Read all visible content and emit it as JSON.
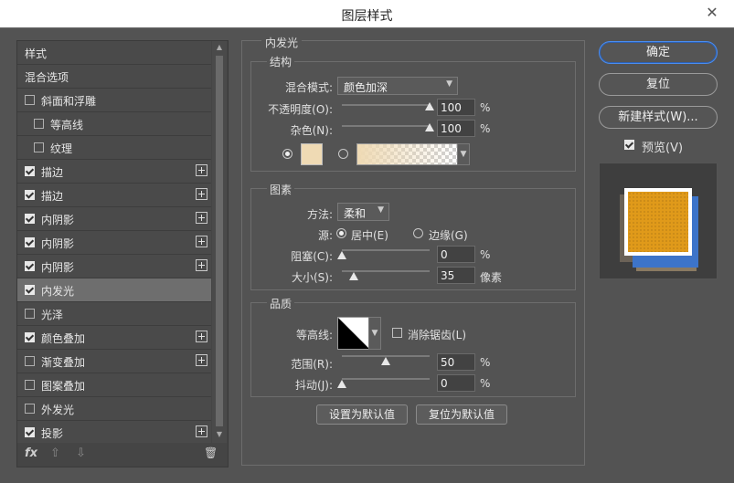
{
  "window": {
    "title": "图层样式",
    "close_glyph": "✕"
  },
  "left": {
    "header": "样式",
    "items": [
      {
        "label": "混合选项",
        "checkbox": false,
        "checked": false,
        "plus": false,
        "active": false,
        "indent": 0
      },
      {
        "label": "斜面和浮雕",
        "checkbox": true,
        "checked": false,
        "plus": false,
        "active": false,
        "indent": 0
      },
      {
        "label": "等高线",
        "checkbox": true,
        "checked": false,
        "plus": false,
        "active": false,
        "indent": 1
      },
      {
        "label": "纹理",
        "checkbox": true,
        "checked": false,
        "plus": false,
        "active": false,
        "indent": 1
      },
      {
        "label": "描边",
        "checkbox": true,
        "checked": true,
        "plus": true,
        "active": false,
        "indent": 0
      },
      {
        "label": "描边",
        "checkbox": true,
        "checked": true,
        "plus": true,
        "active": false,
        "indent": 0
      },
      {
        "label": "内阴影",
        "checkbox": true,
        "checked": true,
        "plus": true,
        "active": false,
        "indent": 0
      },
      {
        "label": "内阴影",
        "checkbox": true,
        "checked": true,
        "plus": true,
        "active": false,
        "indent": 0
      },
      {
        "label": "内阴影",
        "checkbox": true,
        "checked": true,
        "plus": true,
        "active": false,
        "indent": 0
      },
      {
        "label": "内发光",
        "checkbox": true,
        "checked": true,
        "plus": false,
        "active": true,
        "indent": 0
      },
      {
        "label": "光泽",
        "checkbox": true,
        "checked": false,
        "plus": false,
        "active": false,
        "indent": 0
      },
      {
        "label": "颜色叠加",
        "checkbox": true,
        "checked": true,
        "plus": true,
        "active": false,
        "indent": 0
      },
      {
        "label": "渐变叠加",
        "checkbox": true,
        "checked": false,
        "plus": true,
        "active": false,
        "indent": 0
      },
      {
        "label": "图案叠加",
        "checkbox": true,
        "checked": false,
        "plus": false,
        "active": false,
        "indent": 0
      },
      {
        "label": "外发光",
        "checkbox": true,
        "checked": false,
        "plus": false,
        "active": false,
        "indent": 0
      },
      {
        "label": "投影",
        "checkbox": true,
        "checked": true,
        "plus": true,
        "active": false,
        "indent": 0
      }
    ],
    "footer": {
      "fx": "fx",
      "up": "⇧",
      "down": "⇩",
      "trash": "🗑"
    }
  },
  "inner_glow": {
    "title": "内发光",
    "structure": {
      "title": "结构",
      "blend_mode_label": "混合模式:",
      "blend_mode_value": "颜色加深",
      "opacity_label": "不透明度(O):",
      "opacity_value": "100",
      "opacity_unit": "%",
      "opacity_level": 1.0,
      "noise_label": "杂色(N):",
      "noise_value": "100",
      "noise_unit": "%",
      "noise_level": 1.0,
      "glow_color": "#efdab4"
    },
    "elements": {
      "title": "图素",
      "method_label": "方法:",
      "method_value": "柔和",
      "source_label": "源:",
      "source_center": "居中(E)",
      "source_edge": "边缘(G)",
      "choke_label": "阻塞(C):",
      "choke_value": "0",
      "choke_unit": "%",
      "choke_level": 0.0,
      "size_label": "大小(S):",
      "size_value": "35",
      "size_unit": "像素",
      "size_level": 0.14
    },
    "quality": {
      "title": "品质",
      "contour_label": "等高线:",
      "antialias_label": "消除锯齿(L)",
      "range_label": "范围(R):",
      "range_value": "50",
      "range_unit": "%",
      "range_level": 0.5,
      "jitter_label": "抖动(J):",
      "jitter_value": "0",
      "jitter_unit": "%",
      "jitter_level": 0.0
    },
    "make_default": "设置为默认值",
    "reset_default": "复位为默认值"
  },
  "right": {
    "ok": "确定",
    "reset": "复位",
    "new_style": "新建样式(W)...",
    "preview_label": "预览(V)",
    "preview_checked": true
  },
  "colors": {
    "accent": "#4a8df0",
    "preview_fill": "#e09a1a",
    "preview_blue": "#3d74c9"
  }
}
